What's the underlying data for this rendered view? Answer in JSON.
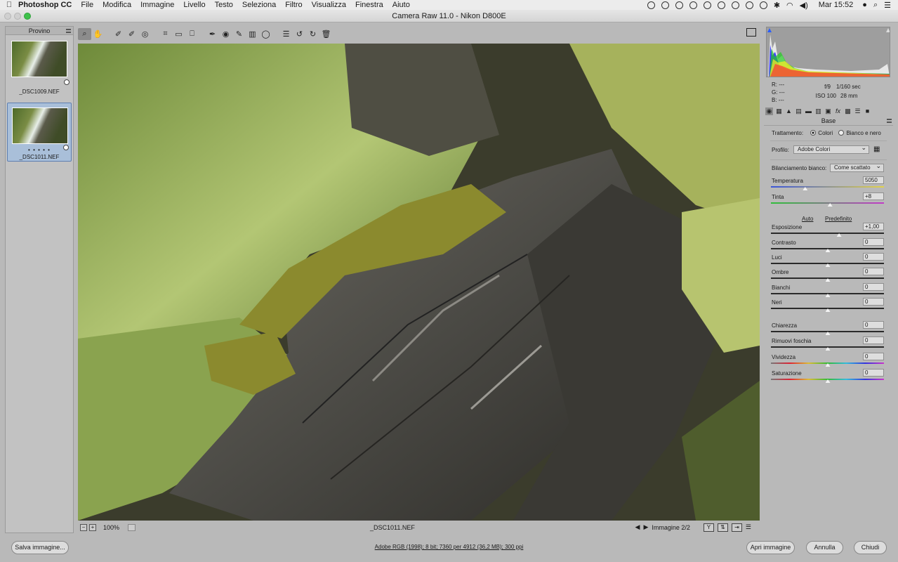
{
  "menubar": {
    "app_name": "Photoshop CC",
    "items": [
      "File",
      "Modifica",
      "Immagine",
      "Livello",
      "Testo",
      "Seleziona",
      "Filtro",
      "Visualizza",
      "Finestra",
      "Aiuto"
    ],
    "clock": "Mar 15:52"
  },
  "window": {
    "title": "Camera Raw 11.0  -  Nikon D800E"
  },
  "filmstrip": {
    "header": "Provino",
    "thumbs": [
      {
        "filename": "_DSC1009.NEF",
        "selected": false
      },
      {
        "filename": "_DSC1011.NEF",
        "selected": true,
        "rating_dots": "• • • • •"
      }
    ]
  },
  "toolbar": {
    "tools": [
      "zoom-tool",
      "hand-tool",
      "white-balance-tool",
      "color-sampler-tool",
      "targeted-adjustment-tool",
      "crop-tool",
      "straighten-tool",
      "transform-tool",
      "spot-removal-tool",
      "red-eye-tool",
      "adjustment-brush-tool",
      "graduated-filter-tool",
      "radial-filter-tool",
      "preferences",
      "rotate-left",
      "rotate-right",
      "trash"
    ]
  },
  "preview_bar": {
    "zoom_minus": "−",
    "zoom_plus": "+",
    "zoom": "100%",
    "filename": "_DSC1011.NEF",
    "image_counter": "Immagine 2/2"
  },
  "readouts": {
    "r": "R:   ---",
    "g": "G:   ---",
    "b": "B:   ---",
    "aperture": "f/9",
    "shutter": "1/160 sec",
    "iso": "ISO 100",
    "focal": "28 mm"
  },
  "panel": {
    "title": "Base",
    "treatment_label": "Trattamento:",
    "treatment_color": "Colori",
    "treatment_bw": "Bianco e nero",
    "profile_label": "Profilo:",
    "profile_value": "Adobe Colori",
    "wb_label": "Bilanciamento bianco:",
    "wb_value": "Come scattato",
    "auto": "Auto",
    "default": "Predefinito",
    "sliders": [
      {
        "label": "Temperatura",
        "value": "5050",
        "pos": 0.3,
        "track": "temp"
      },
      {
        "label": "Tinta",
        "value": "+8",
        "pos": 0.52,
        "track": "tint"
      },
      {
        "label": "Esposizione",
        "value": "+1,00",
        "pos": 0.6,
        "track": "gray"
      },
      {
        "label": "Contrasto",
        "value": "0",
        "pos": 0.5,
        "track": "gray"
      },
      {
        "label": "Luci",
        "value": "0",
        "pos": 0.5,
        "track": "gray"
      },
      {
        "label": "Ombre",
        "value": "0",
        "pos": 0.5,
        "track": "gray"
      },
      {
        "label": "Bianchi",
        "value": "0",
        "pos": 0.5,
        "track": "gray"
      },
      {
        "label": "Neri",
        "value": "0",
        "pos": 0.5,
        "track": "gray"
      },
      {
        "label": "Chiarezza",
        "value": "0",
        "pos": 0.5,
        "track": "gray"
      },
      {
        "label": "Rimuovi foschia",
        "value": "0",
        "pos": 0.5,
        "track": "gray"
      },
      {
        "label": "Vividezza",
        "value": "0",
        "pos": 0.5,
        "track": "vivid"
      },
      {
        "label": "Saturazione",
        "value": "0",
        "pos": 0.5,
        "track": "vivid"
      }
    ]
  },
  "bottom": {
    "save": "Salva immagine...",
    "workflow": "Adobe RGB (1998); 8 bit; 7360 per 4912 (36,2 MB); 300 ppi",
    "open": "Apri immagine",
    "cancel": "Annulla",
    "done": "Chiudi"
  },
  "colors": {
    "accent": "#5d7fb2",
    "panel_bg": "#b9b9b9"
  }
}
